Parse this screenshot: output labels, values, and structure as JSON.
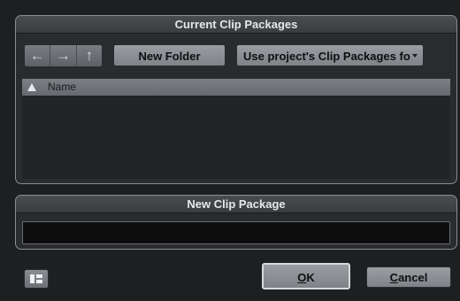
{
  "browse_panel": {
    "title": "Current Clip Packages",
    "nav": {
      "back_icon": "arrow-left-icon",
      "back_glyph": "←",
      "forward_icon": "arrow-right-icon",
      "forward_glyph": "→",
      "up_icon": "arrow-up-icon",
      "up_glyph": "↑"
    },
    "new_folder_label": "New Folder",
    "location_select_value": "Use project's Clip Packages fo",
    "list": {
      "columns": [
        {
          "label": "Name",
          "sort": "ascending"
        }
      ],
      "rows": []
    }
  },
  "new_package_panel": {
    "title": "New Clip Package",
    "name_value": ""
  },
  "footer": {
    "layout_toggle_icon": "layout-toggle-icon",
    "ok_mnemonic": "O",
    "ok_rest": "K",
    "cancel_mnemonic": "C",
    "cancel_rest": "ancel"
  },
  "colors": {
    "background": "#1e1f21",
    "panel": "#2a2b2e",
    "button": "#9a9da2",
    "header": "#7c7f84"
  }
}
